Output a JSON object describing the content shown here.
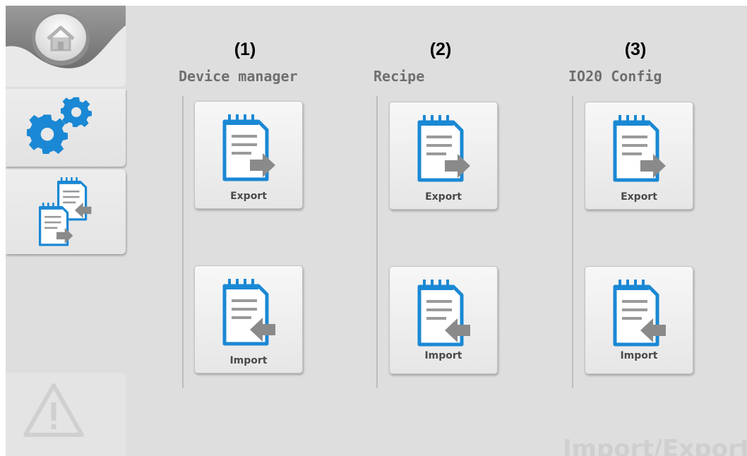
{
  "screen_title": "Import/Export",
  "columns": [
    {
      "number": "(1)",
      "title": "Device manager",
      "export_label": "Export",
      "import_label": "Import"
    },
    {
      "number": "(2)",
      "title": "Recipe",
      "export_label": "Export",
      "import_label": "Import"
    },
    {
      "number": "(3)",
      "title": "IO20 Config",
      "export_label": "Export",
      "import_label": "Import"
    }
  ],
  "sidebar": {
    "items": [
      {
        "icon": "home-icon"
      },
      {
        "icon": "gears-icon"
      },
      {
        "icon": "import-export-icon",
        "active": true
      },
      {
        "icon": "warning-icon"
      }
    ]
  },
  "colors": {
    "accent_blue": "#1a88d4",
    "arrow_gray": "#8a8a8a",
    "header_gray": "#6f6f6f",
    "background": "#dedede"
  }
}
